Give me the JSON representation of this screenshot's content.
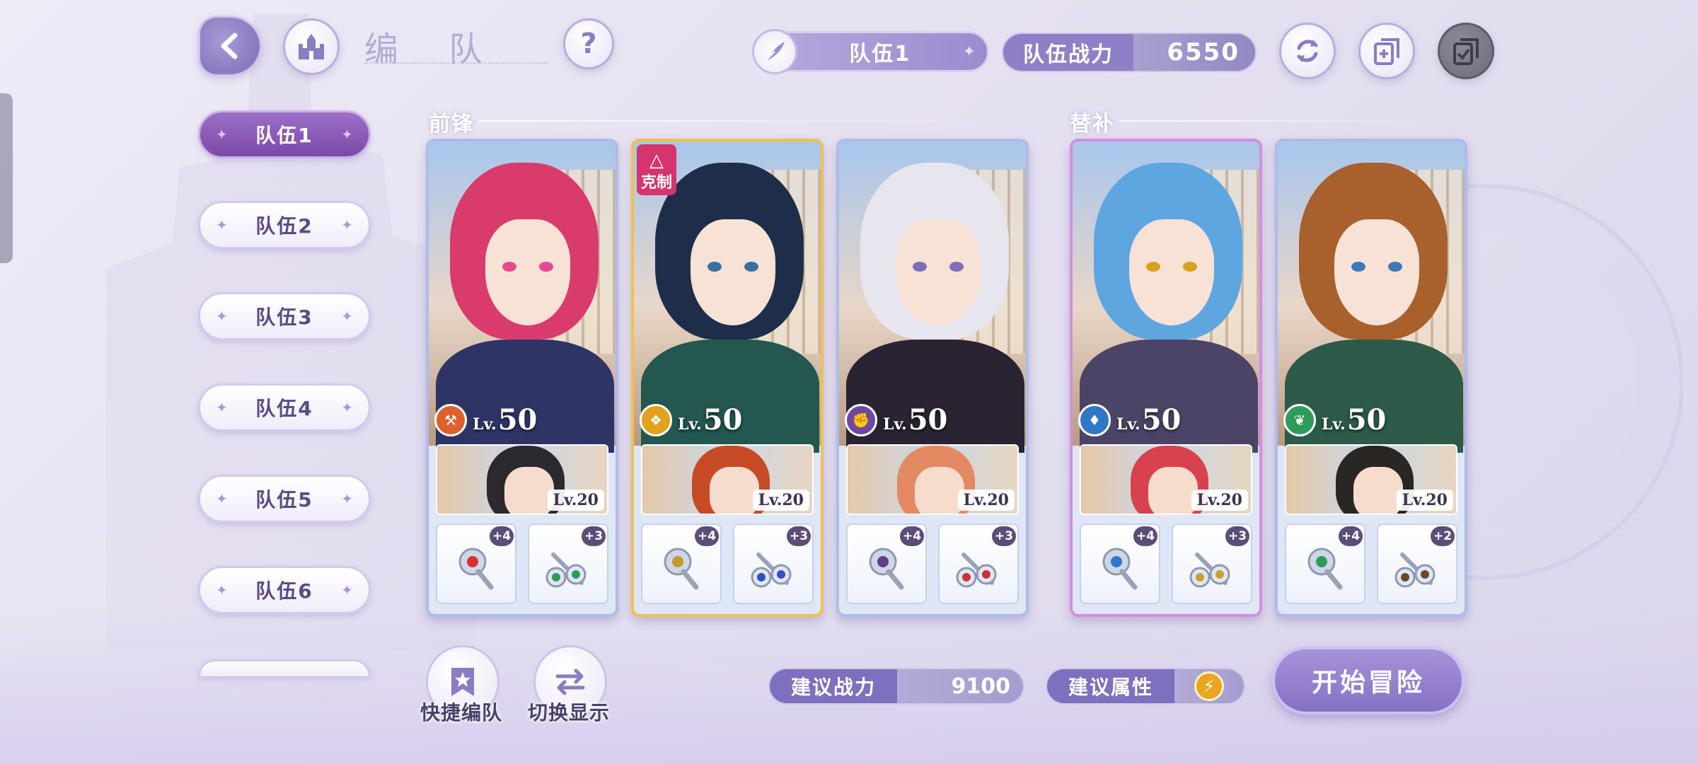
{
  "header": {
    "title": "编 队",
    "team_select": "队伍1",
    "power_label": "队伍战力",
    "power_value": "6550"
  },
  "sidebar": {
    "items": [
      {
        "label": "队伍1",
        "active": true
      },
      {
        "label": "队伍2",
        "active": false
      },
      {
        "label": "队伍3",
        "active": false
      },
      {
        "label": "队伍4",
        "active": false
      },
      {
        "label": "队伍5",
        "active": false
      },
      {
        "label": "队伍6",
        "active": false
      }
    ]
  },
  "sections": {
    "front": "前锋",
    "sub": "替补"
  },
  "cards": [
    {
      "level_prefix": "Lv.",
      "level": "50",
      "element": "orange",
      "support_level": "Lv.20",
      "equip1_plus": "+4",
      "equip2_plus": "+3",
      "hair_color": "#d93b6c",
      "body_color": "#2e3566",
      "eye_color": "#e34b8e",
      "support_hair": "#2a2a2e"
    },
    {
      "level_prefix": "Lv.",
      "level": "50",
      "element": "gold",
      "support_level": "Lv.20",
      "equip1_plus": "+4",
      "equip2_plus": "+3",
      "hair_color": "#1e2e4a",
      "body_color": "#23574f",
      "eye_color": "#3b6fa0",
      "support_hair": "#c74a26",
      "counter": "克制"
    },
    {
      "level_prefix": "Lv.",
      "level": "50",
      "element": "purple",
      "support_level": "Lv.20",
      "equip1_plus": "+4",
      "equip2_plus": "+3",
      "hair_color": "#e7e6ee",
      "body_color": "#2a2332",
      "eye_color": "#7e6fb8",
      "support_hair": "#e38a63"
    },
    {
      "level_prefix": "Lv.",
      "level": "50",
      "element": "blue",
      "support_level": "Lv.20",
      "equip1_plus": "+4",
      "equip2_plus": "+3",
      "hair_color": "#5da6e0",
      "body_color": "#4c4466",
      "eye_color": "#d6a21c",
      "support_hair": "#d8424e"
    },
    {
      "level_prefix": "Lv.",
      "level": "50",
      "element": "green",
      "support_level": "Lv.20",
      "equip1_plus": "+4",
      "equip2_plus": "+2",
      "hair_color": "#a8602c",
      "body_color": "#2d5a49",
      "eye_color": "#3d78b8",
      "support_hair": "#2a2623"
    }
  ],
  "actions": {
    "quick_team": "快捷编队",
    "switch_display": "切换显示"
  },
  "recommend": {
    "power_label": "建议战力",
    "power_value": "9100",
    "attr_label": "建议属性"
  },
  "start_button": "开始冒险",
  "colors": {
    "accent": "#8571c3",
    "active_tab": "#7a49a8",
    "element_orange": "#e0602c",
    "element_gold": "#e3a11c",
    "element_purple": "#6b4aa0",
    "element_blue": "#2f78c8",
    "element_green": "#2f9b5a"
  }
}
